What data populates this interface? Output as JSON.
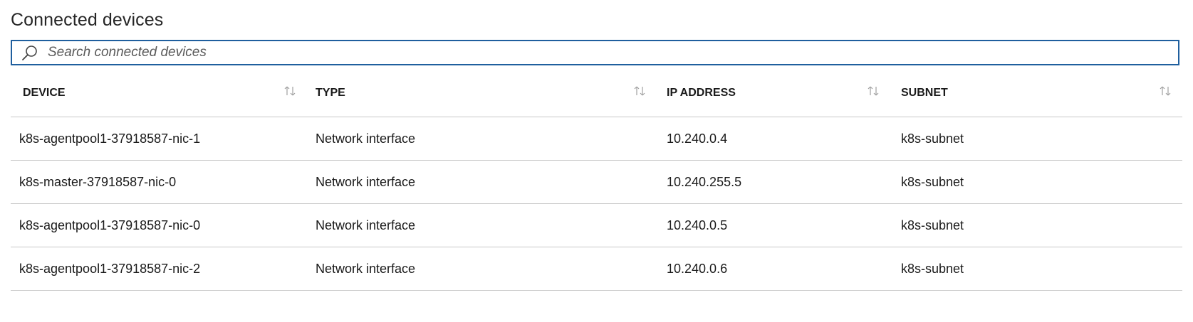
{
  "page": {
    "title": "Connected devices"
  },
  "search": {
    "placeholder": "Search connected devices",
    "value": ""
  },
  "table": {
    "columns": [
      "DEVICE",
      "TYPE",
      "IP ADDRESS",
      "SUBNET"
    ],
    "rows": [
      [
        "k8s-agentpool1-37918587-nic-1",
        "Network interface",
        "10.240.0.4",
        "k8s-subnet"
      ],
      [
        "k8s-master-37918587-nic-0",
        "Network interface",
        "10.240.255.5",
        "k8s-subnet"
      ],
      [
        "k8s-agentpool1-37918587-nic-0",
        "Network interface",
        "10.240.0.5",
        "k8s-subnet"
      ],
      [
        "k8s-agentpool1-37918587-nic-2",
        "Network interface",
        "10.240.0.6",
        "k8s-subnet"
      ]
    ]
  },
  "colors": {
    "search_border": "#1f5f9e",
    "divider": "#c8c8c8",
    "sort_icon": "#a0a0a0"
  },
  "icons": {
    "search": "search-icon",
    "sort": "sort-arrows-icon"
  }
}
